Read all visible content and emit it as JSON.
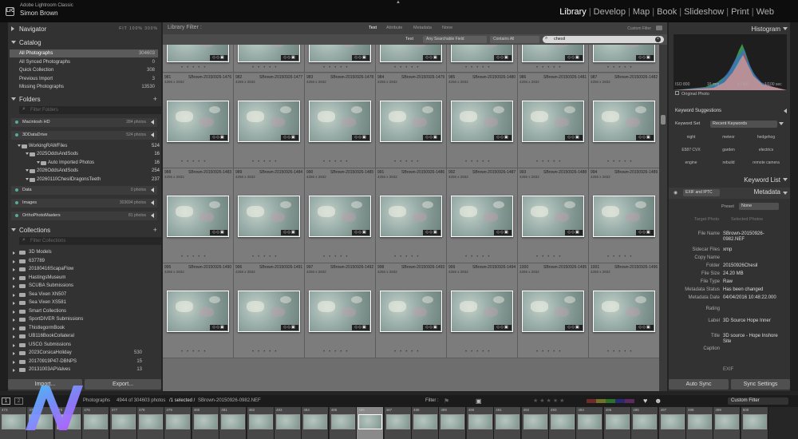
{
  "app": {
    "product": "Adobe Lightroom Classic",
    "user": "Simon Brown",
    "logo": "LrC"
  },
  "modules": [
    "Library",
    "Develop",
    "Map",
    "Book",
    "Slideshow",
    "Print",
    "Web"
  ],
  "active_module": "Library",
  "navigator": {
    "title": "Navigator",
    "zoom": [
      "FIT",
      "100%",
      "300%"
    ]
  },
  "catalog": {
    "title": "Catalog",
    "items": [
      {
        "label": "All Photographs",
        "count": "304603"
      },
      {
        "label": "All Synced Photographs",
        "count": "0"
      },
      {
        "label": "Quick Collection",
        "count": "308"
      },
      {
        "label": "Previous Import",
        "count": "3"
      },
      {
        "label": "Missing Photographs",
        "count": "13530"
      }
    ]
  },
  "folders": {
    "title": "Folders",
    "search_placeholder": "Filter Folders",
    "volumes": [
      {
        "name": "Macintosh HD",
        "total": "284 photos"
      },
      {
        "name": "3DDataDrive",
        "total": "524 photos"
      },
      {
        "name": "Data",
        "total": "0 photos"
      },
      {
        "name": "Images",
        "total": "303694 photos"
      },
      {
        "name": "OrthoPhotoMasters",
        "total": "81 photos"
      }
    ],
    "tree": [
      {
        "name": "WorkingRAWFiles",
        "count": "524"
      },
      {
        "name": "2025OddsAndSods",
        "count": "16"
      },
      {
        "name": "Auto Imported Photos",
        "count": "16"
      },
      {
        "name": "2026OddsAndSods",
        "count": "254"
      },
      {
        "name": "20260110ChesilDragonsTeeth",
        "count": "237"
      }
    ]
  },
  "collections": {
    "title": "Collections",
    "search_placeholder": "Filter Collections",
    "items": [
      {
        "name": "3D Models",
        "count": ""
      },
      {
        "name": "637789",
        "count": ""
      },
      {
        "name": "20180416ScapaFlow",
        "count": ""
      },
      {
        "name": "HastingsMuseum",
        "count": ""
      },
      {
        "name": "SCUBA Submissions",
        "count": ""
      },
      {
        "name": "Sea Vixen XN507",
        "count": ""
      },
      {
        "name": "Sea Vixen XS581",
        "count": ""
      },
      {
        "name": "Smart Collections",
        "count": ""
      },
      {
        "name": "SportDIVER Submissions",
        "count": ""
      },
      {
        "name": "ThistlegormBook",
        "count": ""
      },
      {
        "name": "UB116BookCollateral",
        "count": ""
      },
      {
        "name": "USCG Submissions",
        "count": ""
      },
      {
        "name": "2023CorsicaHoliday",
        "count": "530"
      },
      {
        "name": "20170919P47-DBNPS",
        "count": "15"
      },
      {
        "name": "20131003APValves",
        "count": "13"
      }
    ]
  },
  "left_buttons": {
    "import": "Import...",
    "export": "Export..."
  },
  "filter": {
    "title": "Library Filter :",
    "tabs": [
      "Text",
      "Attribute",
      "Metadata",
      "None"
    ],
    "preset": "Custom Filter",
    "text_label": "Text",
    "field": "Any Searchable Field",
    "rule": "Contains All",
    "query": "chesil"
  },
  "grid": {
    "rows": [
      {
        "cells": [
          {
            "num": "981",
            "name": "SBrown-20150926-1476",
            "dim": "4256 x 2832"
          },
          {
            "num": "982",
            "name": "SBrown-20150926-1477",
            "dim": "4256 x 2832"
          },
          {
            "num": "983",
            "name": "SBrown-20150926-1478",
            "dim": "4256 x 2832"
          },
          {
            "num": "984",
            "name": "SBrown-20150926-1479",
            "dim": "4256 x 2832"
          },
          {
            "num": "985",
            "name": "SBrown-20150926-1480",
            "dim": "4256 x 2832"
          },
          {
            "num": "986",
            "name": "SBrown-20150926-1481",
            "dim": "4256 x 2832"
          },
          {
            "num": "987",
            "name": "SBrown-20150926-1482",
            "dim": "4256 x 2832"
          }
        ]
      },
      {
        "cells": [
          {
            "num": "988",
            "name": "SBrown-20150926-1483",
            "dim": "4256 x 2832"
          },
          {
            "num": "989",
            "name": "SBrown-20150926-1484",
            "dim": "4256 x 2832"
          },
          {
            "num": "990",
            "name": "SBrown-20150926-1485",
            "dim": "4256 x 2832"
          },
          {
            "num": "991",
            "name": "SBrown-20150926-1486",
            "dim": "4256 x 2832"
          },
          {
            "num": "992",
            "name": "SBrown-20150926-1487",
            "dim": "4256 x 2832"
          },
          {
            "num": "993",
            "name": "SBrown-20150926-1488",
            "dim": "4256 x 2832"
          },
          {
            "num": "994",
            "name": "SBrown-20150926-1489",
            "dim": "4256 x 2832"
          }
        ]
      },
      {
        "cells": [
          {
            "num": "995",
            "name": "SBrown-20150926-1490",
            "dim": "4256 x 2832"
          },
          {
            "num": "996",
            "name": "SBrown-20150926-1491",
            "dim": "4256 x 2832"
          },
          {
            "num": "997",
            "name": "SBrown-20150926-1492",
            "dim": "4256 x 2832"
          },
          {
            "num": "998",
            "name": "SBrown-20150926-1493",
            "dim": "4256 x 2832"
          },
          {
            "num": "999",
            "name": "SBrown-20150926-1494",
            "dim": "4256 x 2832"
          },
          {
            "num": "1000",
            "name": "SBrown-20150926-1495",
            "dim": "4256 x 2832"
          },
          {
            "num": "1001",
            "name": "SBrown-20150926-1496",
            "dim": "4256 x 2832"
          }
        ]
      }
    ]
  },
  "histogram": {
    "title": "Histogram",
    "iso": "ISO 800",
    "focal": "16 mm",
    "aperture": "ƒ / 4.0",
    "shutter": "1/100 sec",
    "original": "Original Photo"
  },
  "keywording": {
    "suggestions": "Keyword Suggestions",
    "set_label": "Keyword Set",
    "set_value": "Recent Keywords",
    "keywords": [
      "night",
      "meteor",
      "hedgehog",
      "E587 CVX",
      "garden",
      "electrics",
      "engine",
      "rebuild",
      "remote camera"
    ]
  },
  "keyword_list": "Keyword List",
  "metadata": {
    "title": "Metadata",
    "view": "EXIF and IPTC",
    "preset_label": "Preset",
    "preset_value": "None",
    "target_a": "Target Photo",
    "target_b": "Selected Photos",
    "fields": [
      {
        "label": "File Name",
        "value": "SBrown-20150926-0982.NEF"
      },
      {
        "label": "Sidecar Files",
        "value": "xmp"
      },
      {
        "label": "Copy Name",
        "value": ""
      },
      {
        "label": "Folder",
        "value": "20150926Chesil"
      },
      {
        "label": "File Size",
        "value": "24.20 MB"
      },
      {
        "label": "File Type",
        "value": "Raw"
      },
      {
        "label": "Metadata Status",
        "value": "Has been changed"
      },
      {
        "label": "Metadata Date",
        "value": "04/04/2016 10:48:22.000"
      },
      {
        "label": "Rating",
        "value": ""
      },
      {
        "label": "Label",
        "value": "3D Source Hope Inner"
      },
      {
        "label": "Title",
        "value": "3D source - Hope Inshore Site"
      },
      {
        "label": "Caption",
        "value": ""
      }
    ],
    "exif": "EXIF"
  },
  "right_buttons": {
    "autosync": "Auto Sync",
    "sync": "Sync Settings"
  },
  "status": {
    "page_btn_1": "1",
    "page_btn_2": "2",
    "source": "Photographs",
    "count": "4944 of 304603 photos",
    "selected": "/1 selected /",
    "selected_file": "SBrown-20150926-0982.NEF",
    "filter_label": "Filter :",
    "filter_preset": "Custom Filter"
  },
  "filmstrip": [
    "473",
    "474",
    "475",
    "476",
    "477",
    "478",
    "479",
    "480",
    "481",
    "482",
    "483",
    "484",
    "485",
    "486",
    "487",
    "488",
    "489",
    "490",
    "491",
    "492",
    "493",
    "494",
    "495",
    "496",
    "497",
    "498",
    "499",
    "500"
  ],
  "colors": {
    "accent": "#ffffff",
    "panel": "#323232",
    "grid_bg": "#6e6e6e",
    "histogram_blue": "#3d6fd0",
    "histogram_green": "#3fae5a",
    "histogram_red": "#d14646"
  }
}
